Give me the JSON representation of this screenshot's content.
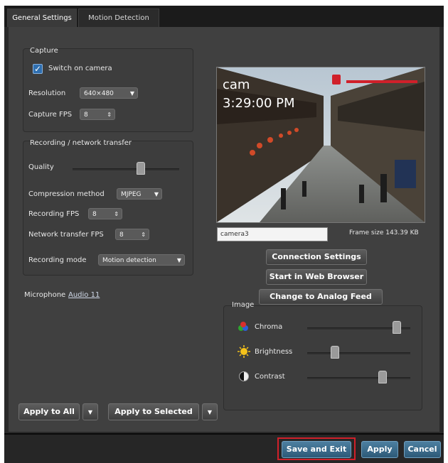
{
  "tabs": [
    {
      "label": "General Settings",
      "active": true
    },
    {
      "label": "Motion Detection",
      "active": false
    }
  ],
  "capture": {
    "title": "Capture",
    "switch_on_label": "Switch on camera",
    "switch_on_checked": true,
    "resolution_label": "Resolution",
    "resolution_value": "640×480",
    "capture_fps_label": "Capture FPS",
    "capture_fps_value": "8"
  },
  "recording": {
    "title": "Recording / network transfer",
    "quality_label": "Quality",
    "quality_level": 0.65,
    "compression_label": "Compression method",
    "compression_value": "MJPEG",
    "recording_fps_label": "Recording FPS",
    "recording_fps_value": "8",
    "network_fps_label": "Network transfer FPS",
    "network_fps_value": "8",
    "mode_label": "Recording mode",
    "mode_value": "Motion detection"
  },
  "microphone": {
    "label": "Microphone",
    "value": "Audio 11"
  },
  "preview": {
    "overlay_name": "cam",
    "overlay_time": "3:29:00 PM",
    "camera_name": "camera3",
    "frame_size": "Frame size 143.39 KB"
  },
  "actions": {
    "connection_settings": "Connection Settings",
    "start_browser": "Start in Web Browser",
    "change_analog": "Change to Analog Feed"
  },
  "image": {
    "title": "Image",
    "chroma_label": "Chroma",
    "chroma_level": 0.9,
    "brightness_label": "Brightness",
    "brightness_level": 0.25,
    "contrast_label": "Contrast",
    "contrast_level": 0.75
  },
  "apply_buttons": {
    "apply_all": "Apply to All",
    "apply_selected": "Apply to Selected"
  },
  "footer": {
    "save_exit": "Save and Exit",
    "apply": "Apply",
    "cancel": "Cancel",
    "highlight_color": "#d0202a"
  },
  "colors": {
    "accent_checkbox": "#2f6fb0",
    "background": "#404040"
  }
}
